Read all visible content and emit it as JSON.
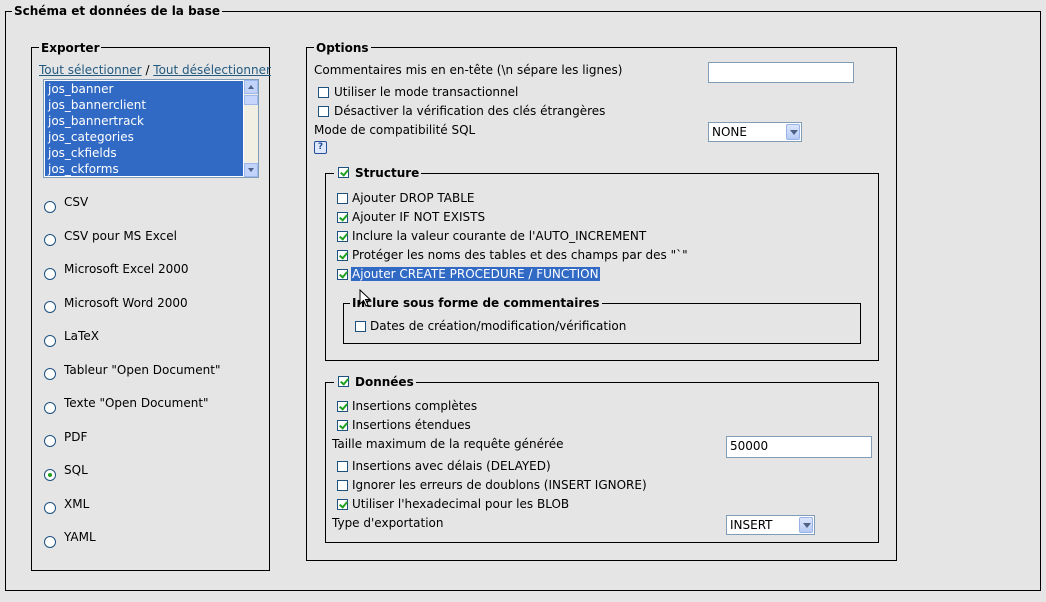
{
  "main": {
    "title": "Schéma et données de la base"
  },
  "exporter": {
    "title": "Exporter",
    "select_all": "Tout sélectionner",
    "separator": " / ",
    "deselect_all": "Tout désélectionner",
    "tables": [
      "jos_banner",
      "jos_bannerclient",
      "jos_bannertrack",
      "jos_categories",
      "jos_ckfields",
      "jos_ckforms"
    ],
    "formats": [
      {
        "label": "CSV",
        "checked": false
      },
      {
        "label": "CSV pour MS Excel",
        "checked": false
      },
      {
        "label": "Microsoft Excel 2000",
        "checked": false
      },
      {
        "label": "Microsoft Word 2000",
        "checked": false
      },
      {
        "label": "LaTeX",
        "checked": false
      },
      {
        "label": "Tableur \"Open Document\"",
        "checked": false
      },
      {
        "label": "Texte \"Open Document\"",
        "checked": false
      },
      {
        "label": "PDF",
        "checked": false
      },
      {
        "label": "SQL",
        "checked": true
      },
      {
        "label": "XML",
        "checked": false
      },
      {
        "label": "YAML",
        "checked": false
      }
    ]
  },
  "options": {
    "title": "Options",
    "header_comments_label": "Commentaires mis en en-tête (\\n sépare les lignes)",
    "header_comments_value": "",
    "transactional": {
      "label": "Utiliser le mode transactionnel",
      "checked": false
    },
    "disable_fk": {
      "label": "Désactiver la vérification des clés étrangères",
      "checked": false
    },
    "compat_label": "Mode de compatibilité SQL",
    "compat_value": "NONE",
    "help_glyph": "?"
  },
  "structure": {
    "title": "Structure",
    "checked": true,
    "items": [
      {
        "label": "Ajouter DROP TABLE",
        "checked": false
      },
      {
        "label": "Ajouter IF NOT EXISTS",
        "checked": true
      },
      {
        "label": "Inclure la valeur courante de l'AUTO_INCREMENT",
        "checked": true
      },
      {
        "label": "Protéger les noms des tables et des champs par des \"`\"",
        "checked": true
      },
      {
        "label": "Ajouter CREATE PROCEDURE / FUNCTION",
        "checked": true
      }
    ],
    "comments_group": {
      "title": "Inclure sous forme de commentaires",
      "item": {
        "label": "Dates de création/modification/vérification",
        "checked": false
      }
    }
  },
  "donnees": {
    "title": "Données",
    "checked": true,
    "complete_inserts": {
      "label": "Insertions complètes",
      "checked": true
    },
    "extended_inserts": {
      "label": "Insertions étendues",
      "checked": true
    },
    "max_query_label": "Taille maximum de la requête générée",
    "max_query_value": "50000",
    "delayed": {
      "label": "Insertions avec délais (DELAYED)",
      "checked": false
    },
    "ignore": {
      "label": "Ignorer les erreurs de doublons (INSERT IGNORE)",
      "checked": false
    },
    "hex_blob": {
      "label": "Utiliser l'hexadecimal pour les BLOB",
      "checked": true
    },
    "export_type_label": "Type d'exportation",
    "export_type_value": "INSERT"
  },
  "colors": {
    "background": "#e5e5e5",
    "selection": "#316ac5",
    "link": "#235a81",
    "check": "#21a121",
    "control_border": "#7f9db9"
  }
}
